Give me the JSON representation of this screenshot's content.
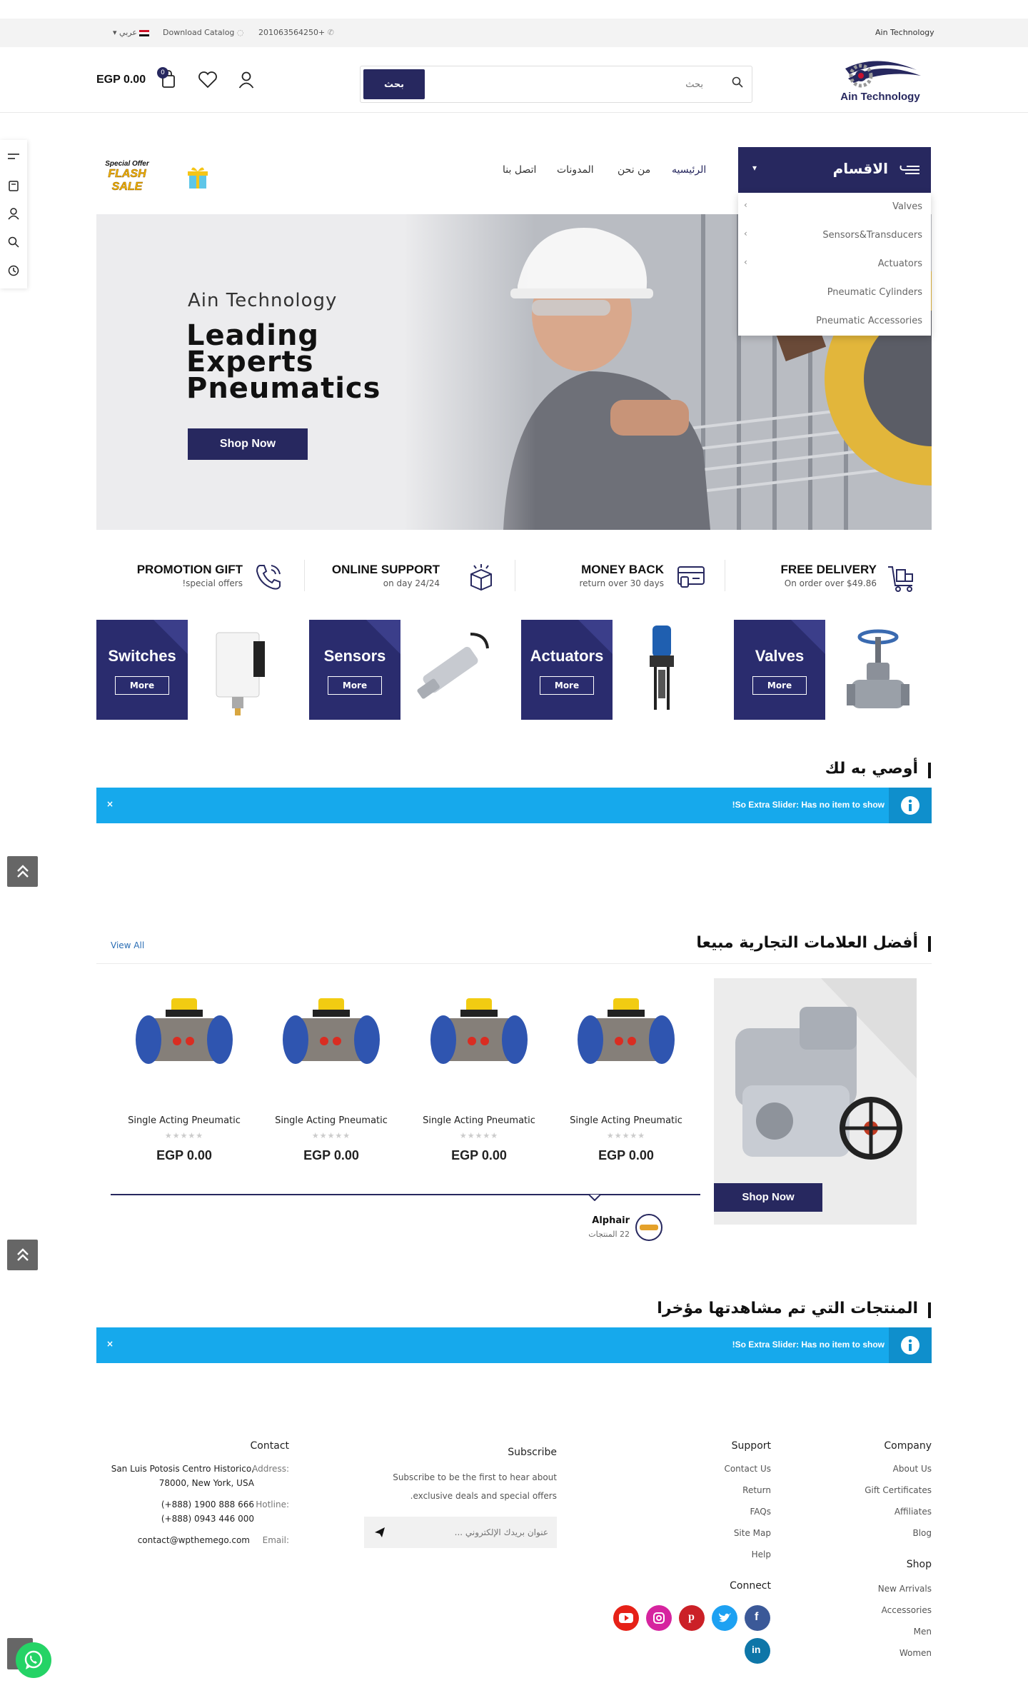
{
  "topbar": {
    "brand": "Ain Technology",
    "phone": "201063564250+",
    "catalog": "Download Catalog",
    "language": "عربي"
  },
  "header": {
    "logo_text": "Ain Technology",
    "search_placeholder": "بحث",
    "search_button": "بحث",
    "cart_badge": "0",
    "cart_total": "EGP 0.00"
  },
  "nav": {
    "categories_title": "الاقسام",
    "links": [
      "الرئيسيه",
      "من نحن",
      "المدونات",
      "اتصل بنا"
    ],
    "promo_top": "Special Offer",
    "promo_main": "FLASH SALE"
  },
  "categories": [
    "Valves",
    "Sensors&Transducers",
    "Actuators",
    "Pneumatic Cylinders",
    "Pneumatic Accessories"
  ],
  "hero": {
    "eyebrow": "Ain Technology",
    "line1": "Leading",
    "line2": "Experts",
    "line3": "Pneumatics",
    "button": "Shop Now"
  },
  "features": [
    {
      "title": "FREE DELIVERY",
      "sub": "On order over $49.86"
    },
    {
      "title": "MONEY BACK",
      "sub": "return over 30 days"
    },
    {
      "title": "ONLINE SUPPORT",
      "sub": "on day 24/24"
    },
    {
      "title": "PROMOTION GIFT",
      "sub": "!special offers"
    }
  ],
  "category_banners": [
    {
      "title": "Switches",
      "button": "More"
    },
    {
      "title": "Sensors",
      "button": "More"
    },
    {
      "title": "Actuators",
      "button": "More"
    },
    {
      "title": "Valves",
      "button": "More"
    }
  ],
  "recommended": {
    "title": "أوصي به لك",
    "notice": "!So Extra Slider: Has no item to show",
    "close": "×"
  },
  "brands": {
    "title": "أفضل العلامات التجارية مبيعا",
    "view_all": "View All",
    "banner_button": "Shop Now",
    "products": [
      {
        "name": "Single Acting Pneumatic",
        "price": "EGP 0.00",
        "stars": "★★★★★"
      },
      {
        "name": "Single Acting Pneumatic",
        "price": "EGP 0.00",
        "stars": "★★★★★"
      },
      {
        "name": "Single Acting Pneumatic",
        "price": "EGP 0.00",
        "stars": "★★★★★"
      },
      {
        "name": "Single Acting Pneumatic",
        "price": "EGP 0.00",
        "stars": "★★★★★"
      }
    ],
    "brand_name": "Alphair",
    "brand_count": "22 المنتجات"
  },
  "recently_viewed": {
    "title": "المنتجات التي تم مشاهدتها مؤخرا",
    "notice": "!So Extra Slider: Has no item to show",
    "close": "×"
  },
  "footer": {
    "company_title": "Company",
    "company_links": [
      "About Us",
      "Gift Certificates",
      "Affiliates",
      "Blog"
    ],
    "shop_title": "Shop",
    "shop_links": [
      "New Arrivals",
      "Accessories",
      "Men",
      "Women"
    ],
    "support_title": "Support",
    "support_links": [
      "Contact Us",
      "Return",
      "FAQs",
      "Site Map",
      "Help"
    ],
    "connect_title": "Connect",
    "subscribe_title": "Subscribe",
    "subscribe_text1": "Subscribe to be the first to hear about",
    "subscribe_text2": "exclusive deals and special offers.",
    "email_placeholder": "عنوان بريدك الإلكتروني ...",
    "contact_title": "Contact",
    "address_label": "Address:",
    "address_line1": "San Luis Potosis Centro Historico,",
    "address_line2": "78000, New York, USA",
    "hotline_label": "Hotline:",
    "hotline1": "(+888) 1900 888 666",
    "hotline2": "(+888) 0943 446 000",
    "email_label": "Email:",
    "email": "contact@wpthemego.com"
  },
  "colors": {
    "brand_navy": "#27285f",
    "notice_blue": "#16a9ec",
    "whatsapp_green": "#25d366"
  }
}
